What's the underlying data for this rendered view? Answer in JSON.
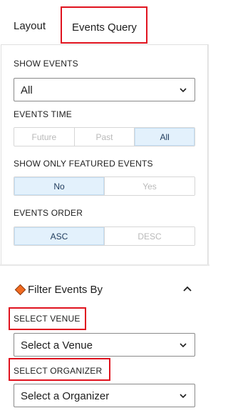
{
  "tabs": {
    "layout": "Layout",
    "events_query": "Events Query"
  },
  "show_events": {
    "label": "SHOW EVENTS",
    "value": "All"
  },
  "events_time": {
    "label": "EVENTS TIME",
    "options": [
      "Future",
      "Past",
      "All"
    ],
    "selected": "All"
  },
  "featured": {
    "label": "SHOW ONLY FEATURED EVENTS",
    "options": [
      "No",
      "Yes"
    ],
    "selected": "No"
  },
  "order": {
    "label": "EVENTS ORDER",
    "options": [
      "ASC",
      "DESC"
    ],
    "selected": "ASC"
  },
  "filter": {
    "title": "Filter Events By"
  },
  "venue": {
    "label": "SELECT VENUE",
    "value": "Select a Venue"
  },
  "organizer": {
    "label": "SELECT ORGANIZER",
    "value": "Select a Organizer"
  },
  "colors": {
    "highlight": "#e0131f",
    "selected_bg": "#e3f1fc",
    "diamond": "#f26b21"
  }
}
